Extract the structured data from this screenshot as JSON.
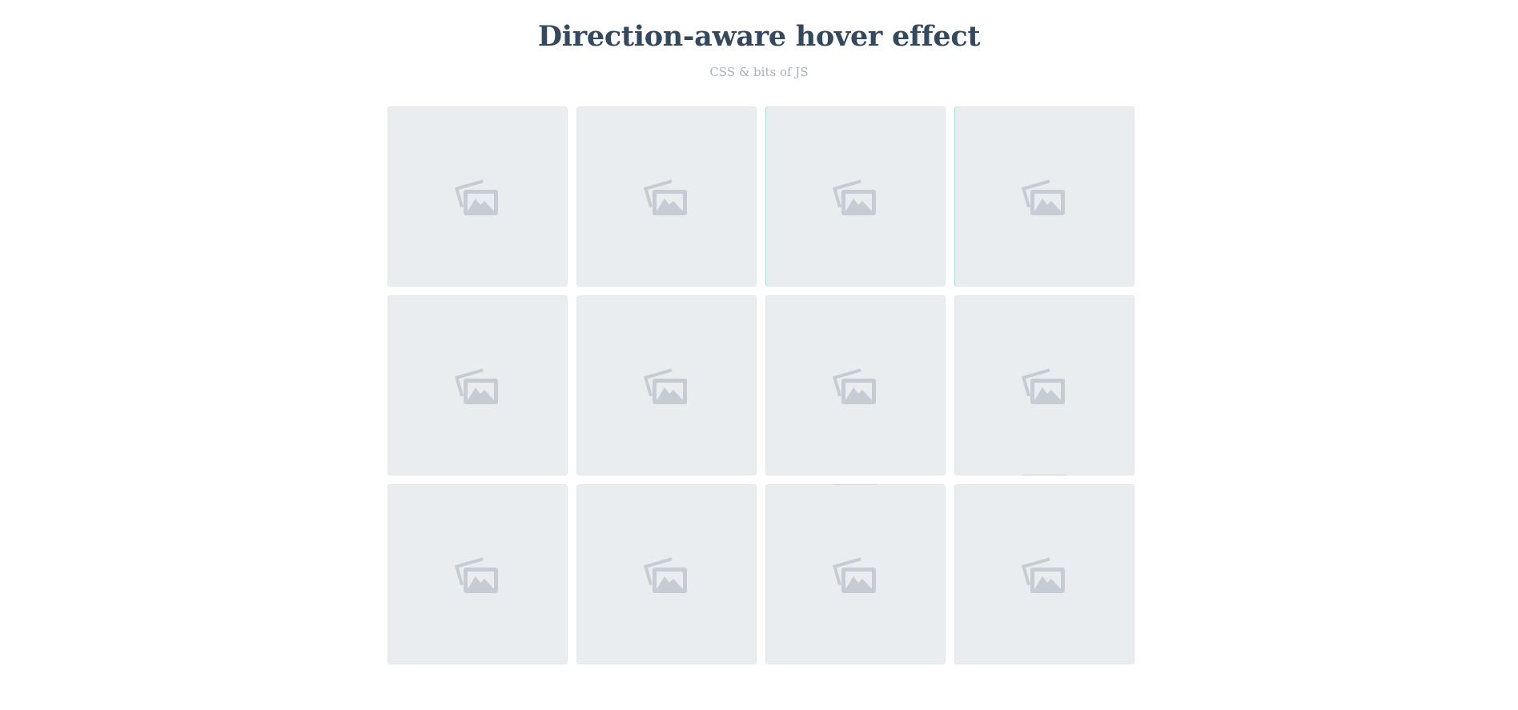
{
  "header": {
    "title": "Direction-aware hover effect",
    "subtitle": "CSS & bits of JS"
  },
  "colors": {
    "title": "#34495e",
    "subtitle": "#a7b1bb",
    "tile_bg": "#e9edef",
    "icon": "#c5ccd3",
    "hover_accent": "#a8e0e2"
  },
  "grid": {
    "tiles": [
      {
        "icon": "image-placeholder-icon"
      },
      {
        "icon": "image-placeholder-icon"
      },
      {
        "icon": "image-placeholder-icon"
      },
      {
        "icon": "image-placeholder-icon"
      },
      {
        "icon": "image-placeholder-icon"
      },
      {
        "icon": "image-placeholder-icon"
      },
      {
        "icon": "image-placeholder-icon"
      },
      {
        "icon": "image-placeholder-icon"
      },
      {
        "icon": "image-placeholder-icon"
      },
      {
        "icon": "image-placeholder-icon"
      },
      {
        "icon": "image-placeholder-icon"
      },
      {
        "icon": "image-placeholder-icon"
      }
    ]
  }
}
